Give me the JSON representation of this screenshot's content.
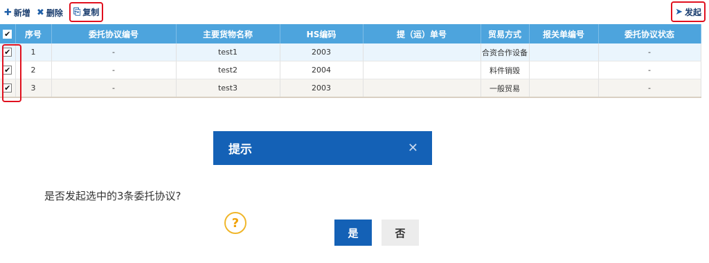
{
  "toolbar": {
    "new_label": "新增",
    "delete_label": "删除",
    "copy_label": "复制",
    "launch_label": "发起"
  },
  "table": {
    "columns": [
      "序号",
      "委托协议编号",
      "主要货物名称",
      "HS编码",
      "提（运）单号",
      "贸易方式",
      "报关单编号",
      "委托协议状态"
    ],
    "rows": [
      {
        "index": "1",
        "agreement_no": "-",
        "goods": "test1",
        "hs": "2003",
        "bill_no": "",
        "trade_mode": "合资合作设备",
        "decl_no": "",
        "status": "-"
      },
      {
        "index": "2",
        "agreement_no": "-",
        "goods": "test2",
        "hs": "2004",
        "bill_no": "",
        "trade_mode": "料件销毁",
        "decl_no": "",
        "status": "-"
      },
      {
        "index": "3",
        "agreement_no": "-",
        "goods": "test3",
        "hs": "2003",
        "bill_no": "",
        "trade_mode": "一般贸易",
        "decl_no": "",
        "status": "-"
      }
    ]
  },
  "dialog": {
    "title": "提示",
    "message": "是否发起选中的3条委托协议?",
    "yes_label": "是",
    "no_label": "否"
  },
  "icons": {
    "check_glyph": "✔",
    "question_glyph": "?",
    "close_glyph": "✕"
  }
}
